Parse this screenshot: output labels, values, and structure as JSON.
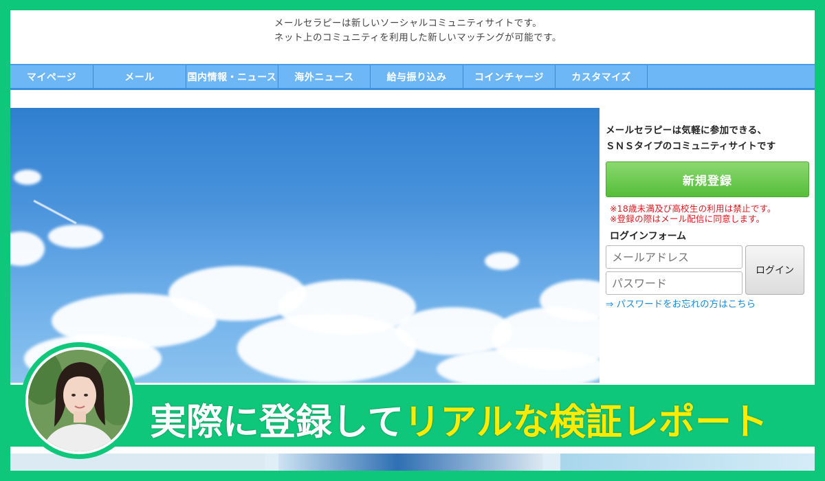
{
  "header": {
    "tagline_1": "メールセラピーは新しいソーシャルコミュニティサイトです。",
    "tagline_2": "ネット上のコミュニティを利用した新しいマッチングが可能です。"
  },
  "nav": {
    "items": [
      {
        "label": "マイページ"
      },
      {
        "label": "メール"
      },
      {
        "label": "国内情報・ニュース"
      },
      {
        "label": "海外ニュース"
      },
      {
        "label": "給与振り込み"
      },
      {
        "label": "コインチャージ"
      },
      {
        "label": "カスタマイズ"
      }
    ]
  },
  "side": {
    "intro_1": "メールセラピーは気軽に参加できる、",
    "intro_2": "ＳＮＳタイプのコミュニティサイトです",
    "register_label": "新規登録",
    "warning_1": "※18歳未満及び高校生の利用は禁止です。",
    "warning_2": "※登録の際はメール配信に同意します。",
    "login_title": "ログインフォーム",
    "email_placeholder": "メールアドレス",
    "password_placeholder": "パスワード",
    "login_label": "ログイン",
    "forgot_link": "⇒ パスワードをお忘れの方はこちら"
  },
  "banner": {
    "text_white": "実際に登録して",
    "text_yellow": "リアルな検証レポート"
  },
  "colors": {
    "frame_green": "#0fc77a",
    "nav_blue": "#6eb7f6",
    "register_green": "#55bd3a",
    "warning_red": "#e0141b",
    "link_blue": "#1d8ad8",
    "banner_yellow": "#ffeb00"
  }
}
